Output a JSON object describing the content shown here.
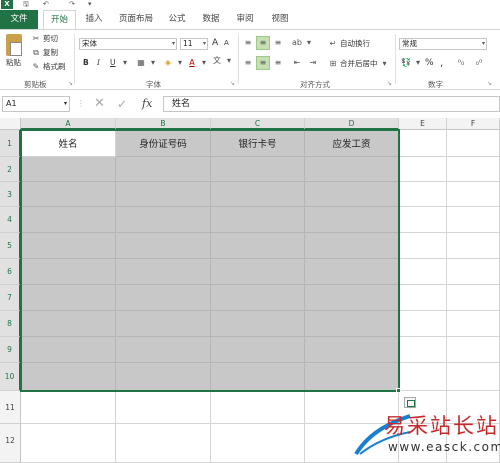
{
  "qat": {
    "app_letter": "X",
    "save_glyph": "🖫",
    "undo_glyph": "↶",
    "redo_glyph": "↷",
    "more_glyph": "▾"
  },
  "tabs": [
    "文件",
    "开始",
    "插入",
    "页面布局",
    "公式",
    "数据",
    "审阅",
    "视图"
  ],
  "ribbon": {
    "clipboard": {
      "paste": "粘贴",
      "cut": "剪切",
      "copy": "复制",
      "format_painter": "格式刷",
      "group": "剪贴板"
    },
    "font": {
      "name": "宋体",
      "size": "11",
      "bold": "B",
      "italic": "I",
      "underline": "U",
      "group": "字体",
      "grow": "A",
      "shrink": "A",
      "wen": "文"
    },
    "alignment": {
      "wrap": "自动换行",
      "merge": "合并后居中",
      "group": "对齐方式"
    },
    "number": {
      "format": "常规",
      "percent": "%",
      "comma": ",",
      "group": "数字"
    }
  },
  "formula_bar": {
    "name_box": "A1",
    "content": "姓名",
    "fx": "fx"
  },
  "columns": [
    "A",
    "B",
    "C",
    "D",
    "E",
    "F"
  ],
  "rows": [
    "1",
    "2",
    "3",
    "4",
    "5",
    "6",
    "7",
    "8",
    "9",
    "10",
    "11",
    "12"
  ],
  "headers": [
    "姓名",
    "身份证号码",
    "银行卡号",
    "应发工资"
  ],
  "watermark": {
    "cn": "易采站长站",
    "url": "www.easck.com"
  },
  "colors": {
    "accent": "#217346",
    "selection_fill": "#c8c8c8"
  }
}
